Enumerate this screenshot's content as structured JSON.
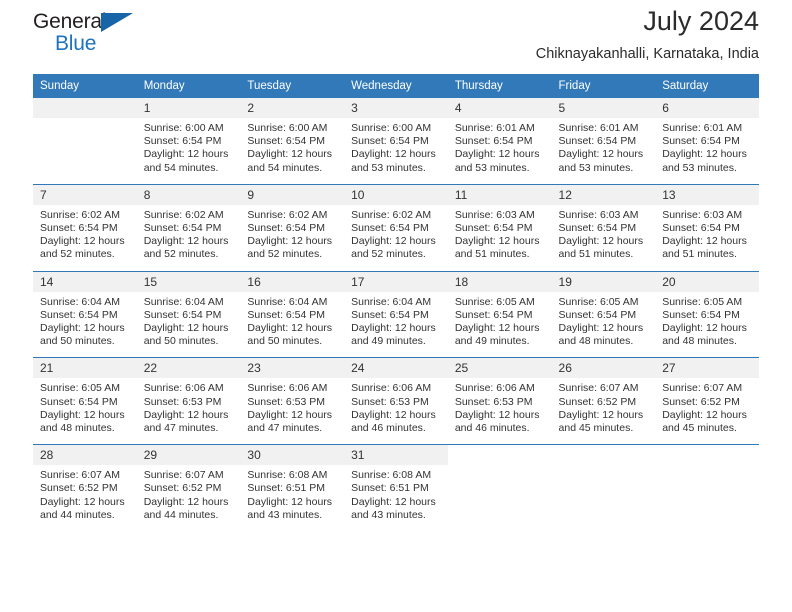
{
  "brand": {
    "name_part1": "General",
    "name_part2": "Blue",
    "triangle_color": "#1764a8",
    "blue": "#1e73be"
  },
  "header": {
    "title": "July 2024",
    "subtitle": "Chiknayakanhalli, Karnataka, India"
  },
  "theme": {
    "header_blue": "#3179b9",
    "daynum_band": "#f1f1f1",
    "text": "#333333"
  },
  "weekdays": [
    "Sunday",
    "Monday",
    "Tuesday",
    "Wednesday",
    "Thursday",
    "Friday",
    "Saturday"
  ],
  "weeks": [
    [
      {
        "day": "",
        "sunrise": "",
        "sunset": "",
        "daylight1": "",
        "daylight2": "",
        "state": "empty"
      },
      {
        "day": "1",
        "sunrise": "Sunrise: 6:00 AM",
        "sunset": "Sunset: 6:54 PM",
        "daylight1": "Daylight: 12 hours",
        "daylight2": "and 54 minutes.",
        "state": "filled"
      },
      {
        "day": "2",
        "sunrise": "Sunrise: 6:00 AM",
        "sunset": "Sunset: 6:54 PM",
        "daylight1": "Daylight: 12 hours",
        "daylight2": "and 54 minutes.",
        "state": "filled"
      },
      {
        "day": "3",
        "sunrise": "Sunrise: 6:00 AM",
        "sunset": "Sunset: 6:54 PM",
        "daylight1": "Daylight: 12 hours",
        "daylight2": "and 53 minutes.",
        "state": "filled"
      },
      {
        "day": "4",
        "sunrise": "Sunrise: 6:01 AM",
        "sunset": "Sunset: 6:54 PM",
        "daylight1": "Daylight: 12 hours",
        "daylight2": "and 53 minutes.",
        "state": "filled"
      },
      {
        "day": "5",
        "sunrise": "Sunrise: 6:01 AM",
        "sunset": "Sunset: 6:54 PM",
        "daylight1": "Daylight: 12 hours",
        "daylight2": "and 53 minutes.",
        "state": "filled"
      },
      {
        "day": "6",
        "sunrise": "Sunrise: 6:01 AM",
        "sunset": "Sunset: 6:54 PM",
        "daylight1": "Daylight: 12 hours",
        "daylight2": "and 53 minutes.",
        "state": "filled"
      }
    ],
    [
      {
        "day": "7",
        "sunrise": "Sunrise: 6:02 AM",
        "sunset": "Sunset: 6:54 PM",
        "daylight1": "Daylight: 12 hours",
        "daylight2": "and 52 minutes.",
        "state": "filled"
      },
      {
        "day": "8",
        "sunrise": "Sunrise: 6:02 AM",
        "sunset": "Sunset: 6:54 PM",
        "daylight1": "Daylight: 12 hours",
        "daylight2": "and 52 minutes.",
        "state": "filled"
      },
      {
        "day": "9",
        "sunrise": "Sunrise: 6:02 AM",
        "sunset": "Sunset: 6:54 PM",
        "daylight1": "Daylight: 12 hours",
        "daylight2": "and 52 minutes.",
        "state": "filled"
      },
      {
        "day": "10",
        "sunrise": "Sunrise: 6:02 AM",
        "sunset": "Sunset: 6:54 PM",
        "daylight1": "Daylight: 12 hours",
        "daylight2": "and 52 minutes.",
        "state": "filled"
      },
      {
        "day": "11",
        "sunrise": "Sunrise: 6:03 AM",
        "sunset": "Sunset: 6:54 PM",
        "daylight1": "Daylight: 12 hours",
        "daylight2": "and 51 minutes.",
        "state": "filled"
      },
      {
        "day": "12",
        "sunrise": "Sunrise: 6:03 AM",
        "sunset": "Sunset: 6:54 PM",
        "daylight1": "Daylight: 12 hours",
        "daylight2": "and 51 minutes.",
        "state": "filled"
      },
      {
        "day": "13",
        "sunrise": "Sunrise: 6:03 AM",
        "sunset": "Sunset: 6:54 PM",
        "daylight1": "Daylight: 12 hours",
        "daylight2": "and 51 minutes.",
        "state": "filled"
      }
    ],
    [
      {
        "day": "14",
        "sunrise": "Sunrise: 6:04 AM",
        "sunset": "Sunset: 6:54 PM",
        "daylight1": "Daylight: 12 hours",
        "daylight2": "and 50 minutes.",
        "state": "filled"
      },
      {
        "day": "15",
        "sunrise": "Sunrise: 6:04 AM",
        "sunset": "Sunset: 6:54 PM",
        "daylight1": "Daylight: 12 hours",
        "daylight2": "and 50 minutes.",
        "state": "filled"
      },
      {
        "day": "16",
        "sunrise": "Sunrise: 6:04 AM",
        "sunset": "Sunset: 6:54 PM",
        "daylight1": "Daylight: 12 hours",
        "daylight2": "and 50 minutes.",
        "state": "filled"
      },
      {
        "day": "17",
        "sunrise": "Sunrise: 6:04 AM",
        "sunset": "Sunset: 6:54 PM",
        "daylight1": "Daylight: 12 hours",
        "daylight2": "and 49 minutes.",
        "state": "filled"
      },
      {
        "day": "18",
        "sunrise": "Sunrise: 6:05 AM",
        "sunset": "Sunset: 6:54 PM",
        "daylight1": "Daylight: 12 hours",
        "daylight2": "and 49 minutes.",
        "state": "filled"
      },
      {
        "day": "19",
        "sunrise": "Sunrise: 6:05 AM",
        "sunset": "Sunset: 6:54 PM",
        "daylight1": "Daylight: 12 hours",
        "daylight2": "and 48 minutes.",
        "state": "filled"
      },
      {
        "day": "20",
        "sunrise": "Sunrise: 6:05 AM",
        "sunset": "Sunset: 6:54 PM",
        "daylight1": "Daylight: 12 hours",
        "daylight2": "and 48 minutes.",
        "state": "filled"
      }
    ],
    [
      {
        "day": "21",
        "sunrise": "Sunrise: 6:05 AM",
        "sunset": "Sunset: 6:54 PM",
        "daylight1": "Daylight: 12 hours",
        "daylight2": "and 48 minutes.",
        "state": "filled"
      },
      {
        "day": "22",
        "sunrise": "Sunrise: 6:06 AM",
        "sunset": "Sunset: 6:53 PM",
        "daylight1": "Daylight: 12 hours",
        "daylight2": "and 47 minutes.",
        "state": "filled"
      },
      {
        "day": "23",
        "sunrise": "Sunrise: 6:06 AM",
        "sunset": "Sunset: 6:53 PM",
        "daylight1": "Daylight: 12 hours",
        "daylight2": "and 47 minutes.",
        "state": "filled"
      },
      {
        "day": "24",
        "sunrise": "Sunrise: 6:06 AM",
        "sunset": "Sunset: 6:53 PM",
        "daylight1": "Daylight: 12 hours",
        "daylight2": "and 46 minutes.",
        "state": "filled"
      },
      {
        "day": "25",
        "sunrise": "Sunrise: 6:06 AM",
        "sunset": "Sunset: 6:53 PM",
        "daylight1": "Daylight: 12 hours",
        "daylight2": "and 46 minutes.",
        "state": "filled"
      },
      {
        "day": "26",
        "sunrise": "Sunrise: 6:07 AM",
        "sunset": "Sunset: 6:52 PM",
        "daylight1": "Daylight: 12 hours",
        "daylight2": "and 45 minutes.",
        "state": "filled"
      },
      {
        "day": "27",
        "sunrise": "Sunrise: 6:07 AM",
        "sunset": "Sunset: 6:52 PM",
        "daylight1": "Daylight: 12 hours",
        "daylight2": "and 45 minutes.",
        "state": "filled"
      }
    ],
    [
      {
        "day": "28",
        "sunrise": "Sunrise: 6:07 AM",
        "sunset": "Sunset: 6:52 PM",
        "daylight1": "Daylight: 12 hours",
        "daylight2": "and 44 minutes.",
        "state": "filled"
      },
      {
        "day": "29",
        "sunrise": "Sunrise: 6:07 AM",
        "sunset": "Sunset: 6:52 PM",
        "daylight1": "Daylight: 12 hours",
        "daylight2": "and 44 minutes.",
        "state": "filled"
      },
      {
        "day": "30",
        "sunrise": "Sunrise: 6:08 AM",
        "sunset": "Sunset: 6:51 PM",
        "daylight1": "Daylight: 12 hours",
        "daylight2": "and 43 minutes.",
        "state": "filled"
      },
      {
        "day": "31",
        "sunrise": "Sunrise: 6:08 AM",
        "sunset": "Sunset: 6:51 PM",
        "daylight1": "Daylight: 12 hours",
        "daylight2": "and 43 minutes.",
        "state": "filled"
      },
      {
        "day": "",
        "sunrise": "",
        "sunset": "",
        "daylight1": "",
        "daylight2": "",
        "state": "blank"
      },
      {
        "day": "",
        "sunrise": "",
        "sunset": "",
        "daylight1": "",
        "daylight2": "",
        "state": "blank"
      },
      {
        "day": "",
        "sunrise": "",
        "sunset": "",
        "daylight1": "",
        "daylight2": "",
        "state": "blank"
      }
    ]
  ]
}
